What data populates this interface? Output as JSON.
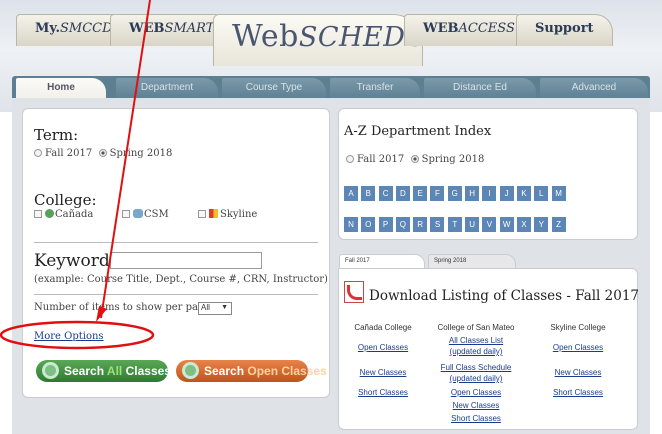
{
  "header": {
    "tabs": [
      {
        "label_plain": "My.",
        "label_italic": "SMCCD"
      },
      {
        "label_plain": "WEB",
        "label_italic": "SMART"
      },
      {
        "label_plain": "WEB",
        "label_italic": "ACCESS"
      },
      {
        "label_plain": "Support",
        "label_italic": ""
      }
    ],
    "brand_plain": "Web",
    "brand_italic": "SCHEDULE"
  },
  "nav": {
    "tabs": [
      "Home",
      "Department",
      "Course Type",
      "Transfer",
      "Distance Ed",
      "Advanced"
    ]
  },
  "search": {
    "term_label": "Term:",
    "terms": [
      "Fall 2017",
      "Spring 2018"
    ],
    "selected_term": "Spring 2018",
    "college_label": "College:",
    "colleges": [
      "Cañada",
      "CSM",
      "Skyline"
    ],
    "keywords_label": "Keywords:",
    "keywords_value": "",
    "keywords_example": "(example: Course Title, Dept., Course #, CRN, Instructor)",
    "number_label": "Number of items to show per page:",
    "number_value": "All",
    "more_options": "More Options",
    "search_all_prefix": "Search ",
    "search_all_highlight": "All",
    "search_all_suffix": " Classes",
    "search_open_prefix": "Search ",
    "search_open_highlight": "Open Classes"
  },
  "az": {
    "title": "A-Z Department Index",
    "terms": [
      "Fall 2017",
      "Spring 2018"
    ],
    "selected_term": "Spring 2018",
    "letters": [
      "A",
      "B",
      "C",
      "D",
      "E",
      "F",
      "G",
      "H",
      "I",
      "J",
      "K",
      "L",
      "M",
      "N",
      "O",
      "P",
      "Q",
      "R",
      "S",
      "T",
      "U",
      "V",
      "W",
      "X",
      "Y",
      "Z"
    ]
  },
  "download": {
    "tabs": [
      "Fall 2017",
      "Spring 2018"
    ],
    "title": "Download Listing of Classes - Fall 2017",
    "columns": [
      {
        "college": "Cañada College",
        "links": [
          "Open Classes",
          "New Classes",
          "Short Classes"
        ]
      },
      {
        "college": "College of San Mateo",
        "links": [
          "All Classes List (updated daily)",
          "Full Class Schedule (updated daily)",
          "Open Classes",
          "New Classes",
          "Short Classes"
        ]
      },
      {
        "college": "Skyline College",
        "links": [
          "Open Classes",
          "New Classes",
          "Short Classes"
        ]
      }
    ]
  },
  "colors": {
    "annotation": "#e01010",
    "nav_bar": "#5d7f92",
    "letter_bg": "#5c86b5"
  }
}
